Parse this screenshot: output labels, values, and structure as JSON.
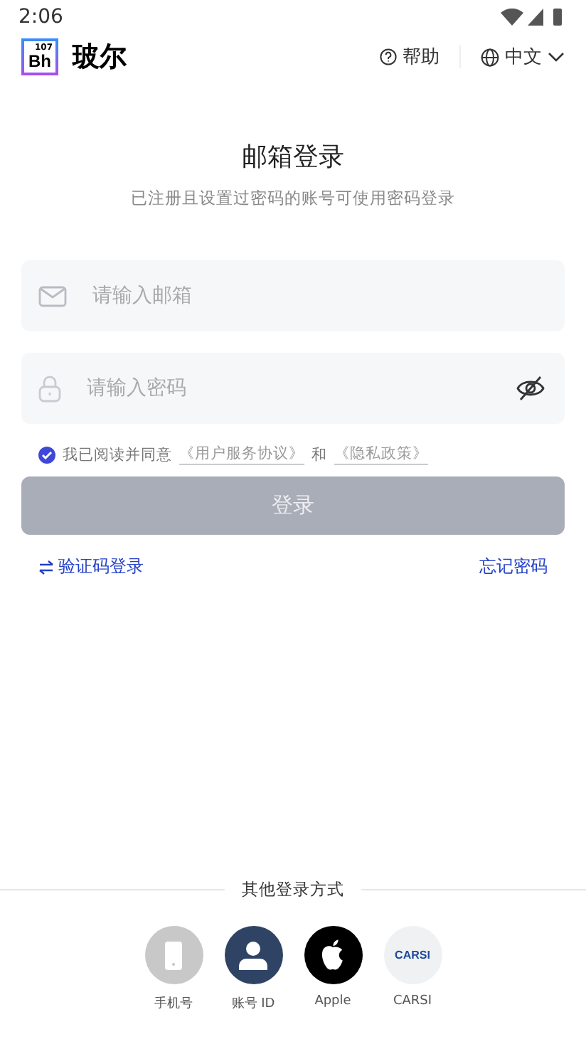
{
  "status_bar": {
    "time": "2:06"
  },
  "header": {
    "logo": {
      "number": "107",
      "symbol": "Bh"
    },
    "app_name": "玻尔",
    "help": "帮助",
    "language": "中文"
  },
  "title": "邮箱登录",
  "subtitle": "已注册且设置过密码的账号可使用密码登录",
  "fields": [
    {
      "kind": "email",
      "placeholder": "请输入邮箱"
    },
    {
      "kind": "password",
      "placeholder": "请输入密码",
      "password_visible": false
    }
  ],
  "agreement": {
    "checked": true,
    "text": "我已阅读并同意",
    "link_1": "《用户服务协议》",
    "joiner": "和",
    "link_2": "《隐私政策》"
  },
  "login_button": {
    "label": "登录",
    "disabled": true
  },
  "switch_link": "验证码登录",
  "forgot_link": "忘记密码",
  "other_login": {
    "heading": "其他登录方式",
    "methods": [
      {
        "kind": "phone",
        "label": "手机号"
      },
      {
        "kind": "account",
        "label": "账号 ID"
      },
      {
        "kind": "apple",
        "label": "Apple"
      },
      {
        "kind": "carsi",
        "label": "CARSI",
        "logo_text": "CARSI"
      }
    ]
  }
}
